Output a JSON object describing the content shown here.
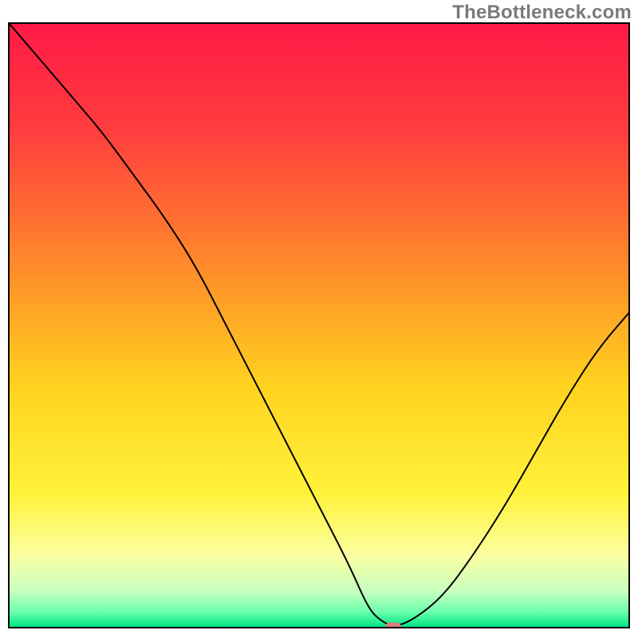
{
  "watermark": "TheBottleneck.com",
  "chart_data": {
    "type": "line",
    "title": "",
    "xlabel": "",
    "ylabel": "",
    "xlim": [
      0,
      100
    ],
    "ylim": [
      0,
      100
    ],
    "grid": false,
    "legend": false,
    "series": [
      {
        "name": "bottleneck-curve",
        "x": [
          0,
          5,
          10,
          15,
          20,
          25,
          30,
          35,
          40,
          45,
          50,
          55,
          58,
          60,
          62,
          65,
          70,
          75,
          80,
          85,
          90,
          95,
          100
        ],
        "y": [
          100,
          94,
          88,
          82,
          75,
          68,
          60,
          50,
          40,
          30,
          20,
          10,
          3,
          1,
          0,
          1,
          5,
          12,
          20,
          29,
          38,
          46,
          52
        ]
      }
    ],
    "minimum_marker": {
      "x": 62,
      "y": 0,
      "color": "#d87e80"
    },
    "background_gradient_stops": [
      {
        "offset": 0.0,
        "color": "#ff1a46"
      },
      {
        "offset": 0.18,
        "color": "#ff3e3e"
      },
      {
        "offset": 0.4,
        "color": "#ff8a2a"
      },
      {
        "offset": 0.6,
        "color": "#ffd21f"
      },
      {
        "offset": 0.78,
        "color": "#fff23a"
      },
      {
        "offset": 0.88,
        "color": "#fbffa0"
      },
      {
        "offset": 0.94,
        "color": "#c9ffbf"
      },
      {
        "offset": 0.975,
        "color": "#6dffad"
      },
      {
        "offset": 1.0,
        "color": "#00e585"
      }
    ]
  }
}
